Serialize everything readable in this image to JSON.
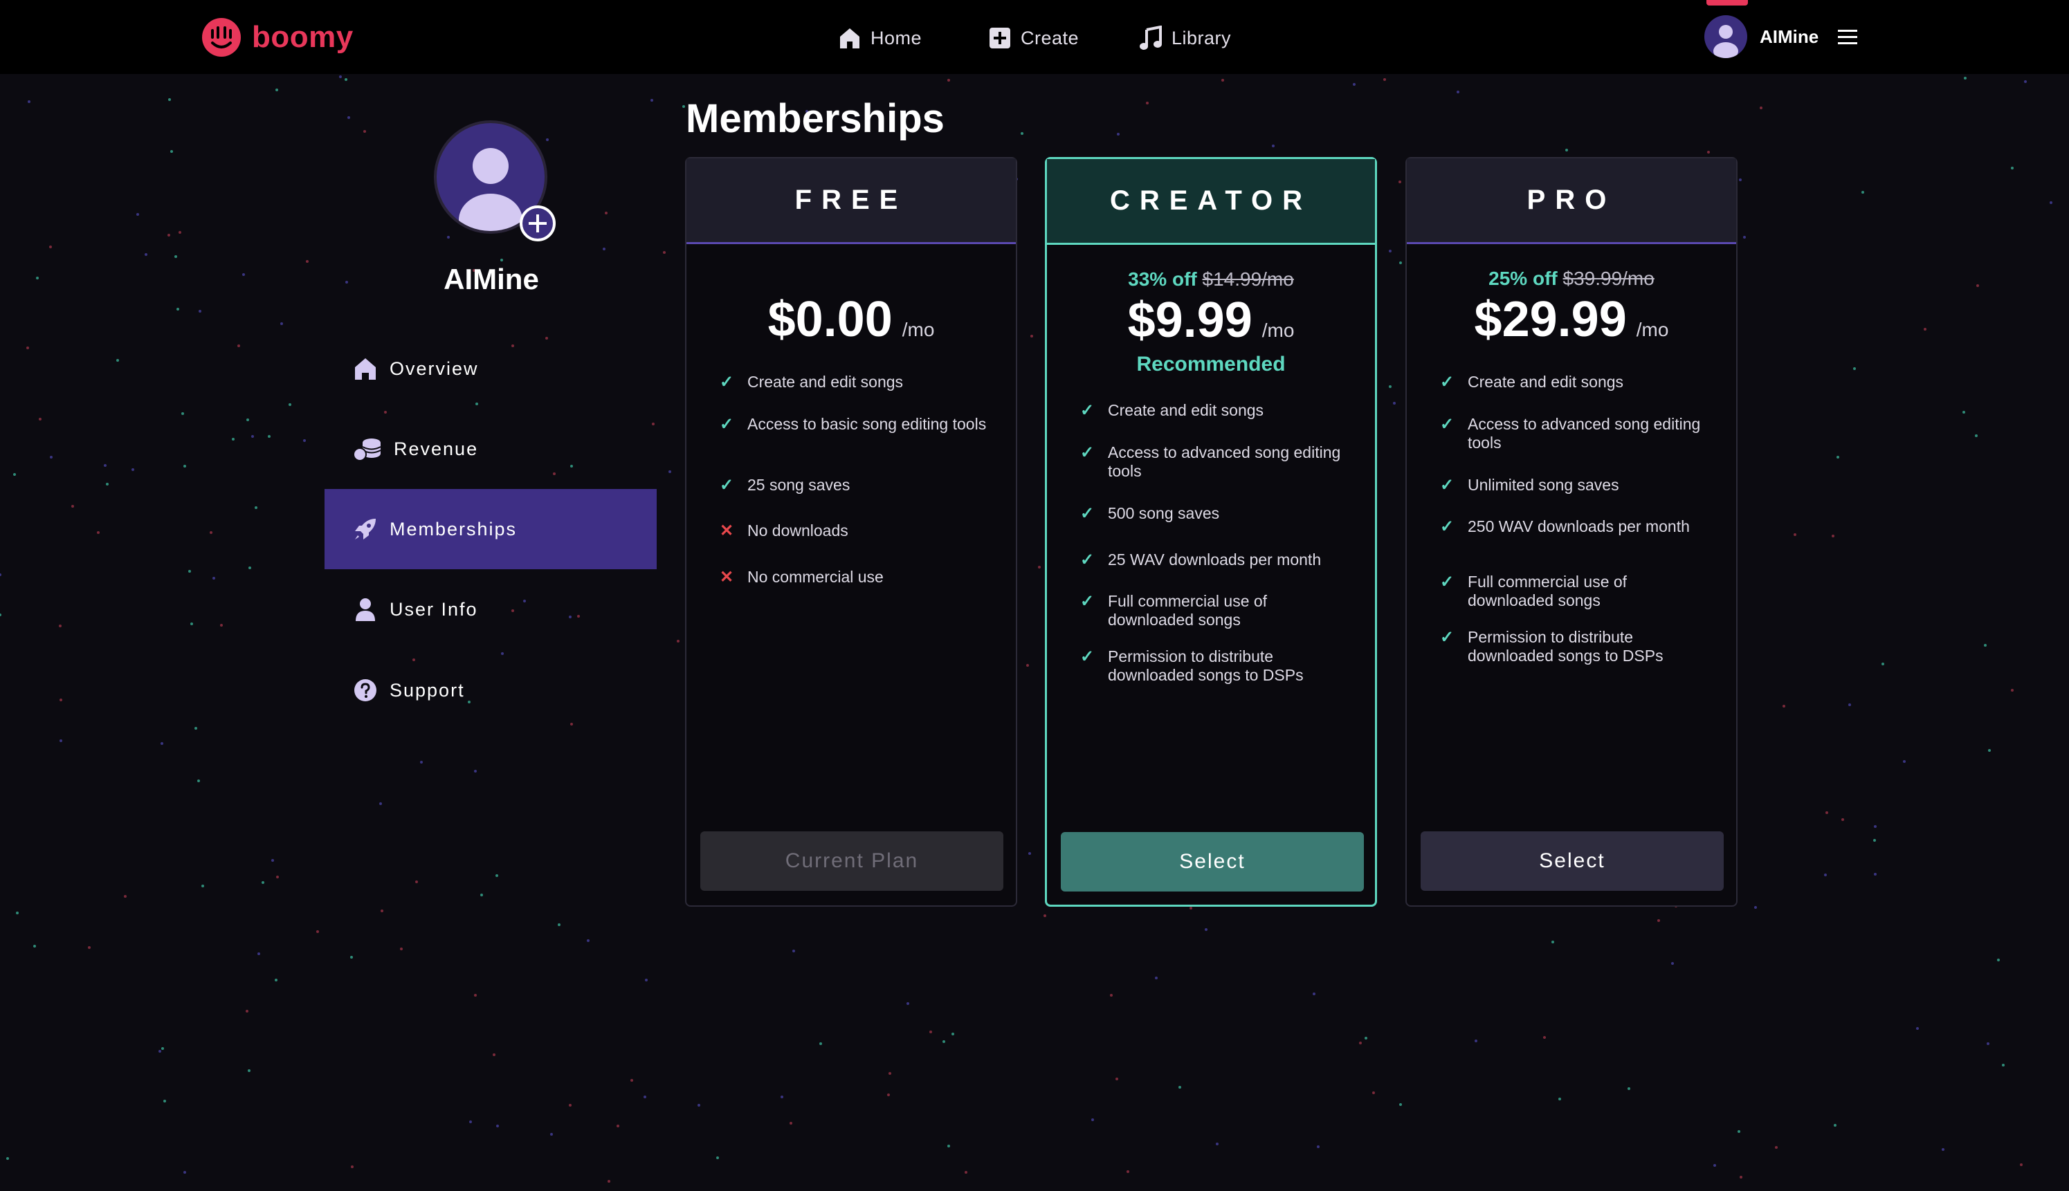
{
  "brand": {
    "name": "boomy",
    "accent": "#e8375a",
    "logo_icon": "boomy-face-icon"
  },
  "nav": {
    "home": {
      "label": "Home",
      "icon": "home-icon"
    },
    "create": {
      "label": "Create",
      "icon": "plus-square-icon"
    },
    "library": {
      "label": "Library",
      "icon": "music-note-icon"
    }
  },
  "account": {
    "name": "AIMine",
    "menu_icon": "hamburger-menu-icon"
  },
  "profile": {
    "name": "AIMine"
  },
  "sidebar": {
    "items": [
      {
        "label": "Overview",
        "icon": "home-icon",
        "active": false
      },
      {
        "label": "Revenue",
        "icon": "coins-icon",
        "active": false
      },
      {
        "label": "Memberships",
        "icon": "rocket-icon",
        "active": true
      },
      {
        "label": "User Info",
        "icon": "user-icon",
        "active": false
      },
      {
        "label": "Support",
        "icon": "help-circle-icon",
        "active": false
      }
    ]
  },
  "page": {
    "title": "Memberships"
  },
  "plans": [
    {
      "name": "FREE",
      "price": "$0.00",
      "unit": "/mo",
      "features": [
        {
          "text": "Create and edit songs",
          "included": true
        },
        {
          "text": "Access to basic song editing tools",
          "included": true
        },
        {
          "text": "25 song saves",
          "included": true
        },
        {
          "text": "No downloads",
          "included": false
        },
        {
          "text": "No commercial use",
          "included": false
        }
      ],
      "cta": "Current Plan"
    },
    {
      "name": "CREATOR",
      "discount": "33% off",
      "old_price": "$14.99/mo",
      "price": "$9.99",
      "unit": "/mo",
      "recommended": "Recommended",
      "features": [
        {
          "text": "Create and edit songs",
          "included": true
        },
        {
          "text": "Access to advanced song editing tools",
          "included": true
        },
        {
          "text": "500 song saves",
          "included": true
        },
        {
          "text": "25 WAV downloads per month",
          "included": true
        },
        {
          "text": "Full commercial use of downloaded songs",
          "included": true
        },
        {
          "text": "Permission to distribute downloaded songs to DSPs",
          "included": true
        }
      ],
      "cta": "Select"
    },
    {
      "name": "PRO",
      "discount": "25% off",
      "old_price": "$39.99/mo",
      "price": "$29.99",
      "unit": "/mo",
      "features": [
        {
          "text": "Create and edit songs",
          "included": true
        },
        {
          "text": "Access to advanced song editing tools",
          "included": true
        },
        {
          "text": "Unlimited song saves",
          "included": true
        },
        {
          "text": "250 WAV downloads per month",
          "included": true
        },
        {
          "text": "Full commercial use of downloaded songs",
          "included": true
        },
        {
          "text": "Permission to distribute downloaded songs to DSPs",
          "included": true
        }
      ],
      "cta": "Select"
    }
  ],
  "colors": {
    "background": "#0c0b11",
    "highlight": "#5ed8c0",
    "sidebar_active": "#3e2f85",
    "cross": "#e8484c"
  }
}
